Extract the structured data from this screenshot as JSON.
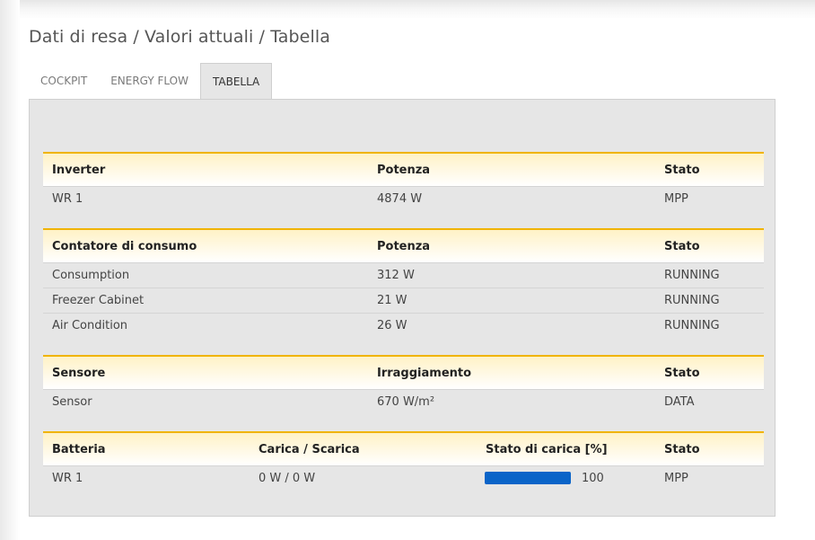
{
  "breadcrumb": "Dati di resa / Valori attuali / Tabella",
  "tabs": [
    {
      "label": "COCKPIT",
      "active": false
    },
    {
      "label": "ENERGY FLOW",
      "active": false
    },
    {
      "label": "TABELLA",
      "active": true
    }
  ],
  "inverter": {
    "headers": [
      "Inverter",
      "Potenza",
      "Stato"
    ],
    "rows": [
      {
        "name": "WR 1",
        "power": "4874 W",
        "state": "MPP"
      }
    ]
  },
  "consumption": {
    "headers": [
      "Contatore di consumo",
      "Potenza",
      "Stato"
    ],
    "rows": [
      {
        "name": "Consumption",
        "power": "312 W",
        "state": "RUNNING"
      },
      {
        "name": "Freezer Cabinet",
        "power": "21 W",
        "state": "RUNNING"
      },
      {
        "name": "Air Condition",
        "power": "26 W",
        "state": "RUNNING"
      }
    ]
  },
  "sensor": {
    "headers": [
      "Sensore",
      "Irraggiamento",
      "Stato"
    ],
    "rows": [
      {
        "name": "Sensor",
        "irradiation": "670 W/m²",
        "state": "DATA"
      }
    ]
  },
  "battery": {
    "headers": [
      "Batteria",
      "Carica / Scarica",
      "Stato di carica [%]",
      "Stato"
    ],
    "rows": [
      {
        "name": "WR 1",
        "charge": "0 W / 0 W",
        "soc": "100",
        "soc_percent": 100,
        "state": "MPP"
      }
    ]
  },
  "colors": {
    "accent": "#f0b400",
    "bar": "#0a64c8",
    "panel": "#e6e6e6"
  }
}
